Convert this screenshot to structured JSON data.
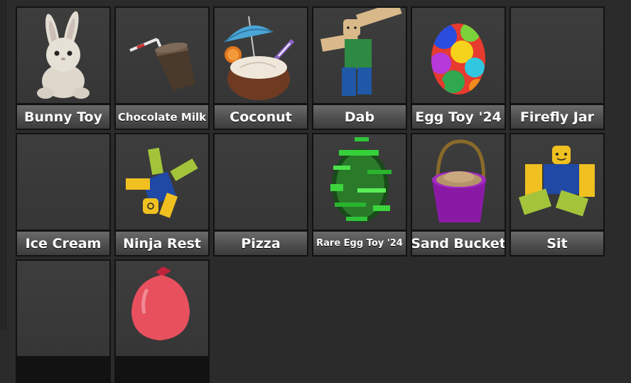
{
  "items": [
    {
      "label": "Bunny Toy",
      "icon": "bunny-toy-icon"
    },
    {
      "label": "Chocolate Milk",
      "icon": "chocolate-milk-icon"
    },
    {
      "label": "Coconut",
      "icon": "coconut-drink-icon"
    },
    {
      "label": "Dab",
      "icon": "dab-emote-icon"
    },
    {
      "label": "Egg Toy '24",
      "icon": "rainbow-egg-icon"
    },
    {
      "label": "Firefly Jar",
      "icon": ""
    },
    {
      "label": "Ice Cream",
      "icon": ""
    },
    {
      "label": "Ninja Rest",
      "icon": "ninja-rest-emote-icon"
    },
    {
      "label": "Pizza",
      "icon": ""
    },
    {
      "label": "Rare Egg Toy '24",
      "icon": "green-glitch-egg-icon"
    },
    {
      "label": "Sand Bucket",
      "icon": "sand-bucket-icon"
    },
    {
      "label": "Sit",
      "icon": "sit-emote-icon"
    },
    {
      "label": "",
      "icon": ""
    },
    {
      "label": "",
      "icon": "red-balloon-icon"
    }
  ],
  "colors": {
    "background": "#2b2b2b",
    "tile_border": "#121212",
    "tile_face": "#3a3a3a",
    "label_text": "#ffffff"
  }
}
